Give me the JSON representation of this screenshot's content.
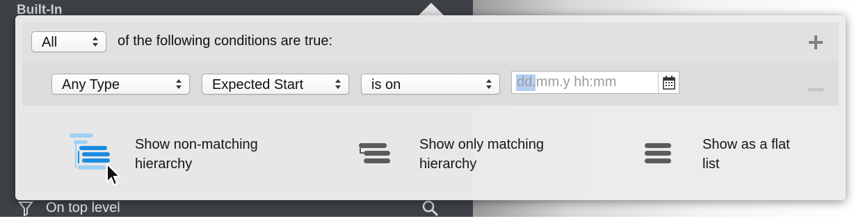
{
  "background": {
    "sidebar_title": "Built-In",
    "footer_label": "On top level"
  },
  "condition_header": {
    "match_select": "All",
    "suffix_text": "of the following conditions are true:"
  },
  "condition_row": {
    "type_select": "Any Type",
    "field_select": "Expected Start",
    "operator_select": "is on",
    "date_placeholder": "dd.mm.y hh:mm"
  },
  "options": [
    {
      "line1": "Show non-matching",
      "line2": "hierarchy"
    },
    {
      "line1": "Show only matching",
      "line2": "hierarchy"
    },
    {
      "line1": "Show as a flat",
      "line2": "list"
    }
  ],
  "colors": {
    "accent_blue": "#1a8de0",
    "light_blue": "#9fd0f4",
    "icon_gray": "#5b5b5b"
  }
}
